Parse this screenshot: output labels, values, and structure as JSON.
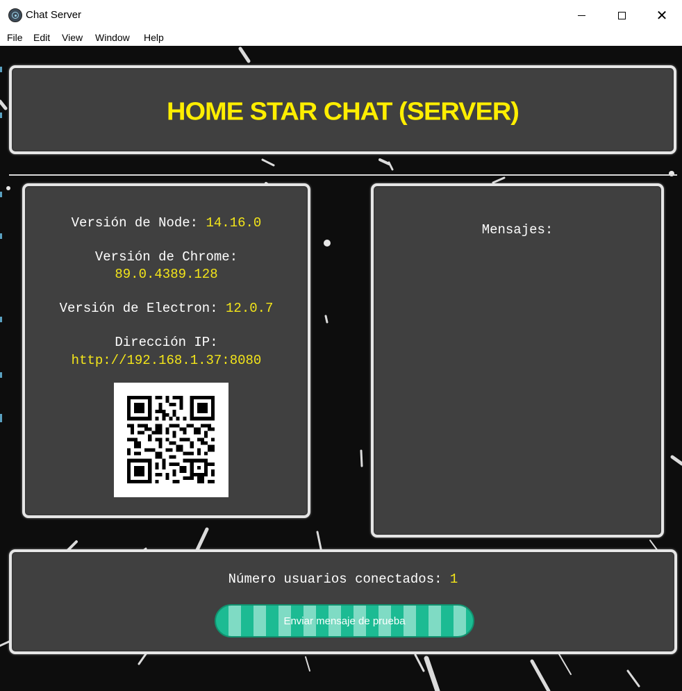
{
  "window": {
    "title": "Chat Server"
  },
  "menu": {
    "items": [
      "File",
      "Edit",
      "View",
      "Window",
      "Help"
    ]
  },
  "header": {
    "title": "HOME STAR CHAT (SERVER)"
  },
  "info": {
    "node_label": "Versión de Node:",
    "node_value": "14.16.0",
    "chrome_label": "Versión de Chrome:",
    "chrome_value": "89.0.4389.128",
    "electron_label": "Versión de Electron:",
    "electron_value": "12.0.7",
    "ip_label": "Dirección IP:",
    "ip_value": "http://192.168.1.37:8080"
  },
  "messages": {
    "title": "Mensajes:"
  },
  "footer": {
    "users_label": "Número usuarios conectados:",
    "users_value": "1",
    "test_button_label": "Enviar mensaje de prueba"
  },
  "colors": {
    "accent_yellow": "#f3e51a",
    "title_yellow": "#ffee00",
    "panel_bg": "#404040",
    "panel_border": "#e6e6e6",
    "button_teal": "#1cbb93",
    "button_teal_light": "#7fdbc4",
    "background": "#0d0d0d"
  },
  "icons": {
    "app": "electron-atom-icon",
    "minimize": "minimize-icon",
    "maximize": "maximize-icon",
    "close": "close-icon"
  }
}
